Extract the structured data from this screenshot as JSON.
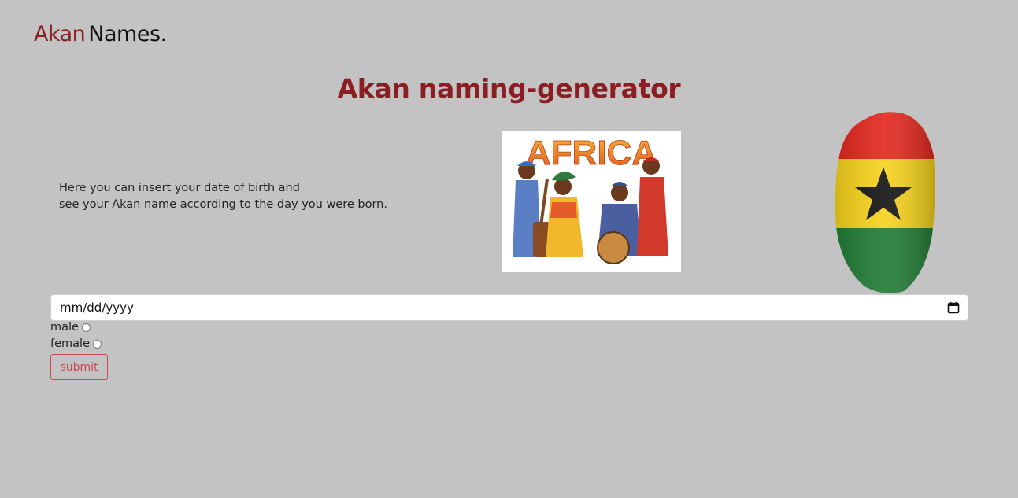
{
  "brand": {
    "accent": "Akan",
    "rest": "Names."
  },
  "title": "Akan naming-generator",
  "intro": {
    "line1": "Here you can insert your date of birth and",
    "line2": "see your Akan name according to the day you were born."
  },
  "images": {
    "africa": {
      "caption": "AFRICA",
      "icon": "africa-illustration"
    },
    "flag": {
      "icon": "ghana-flag-map"
    }
  },
  "form": {
    "date_placeholder": "mm/dd/yyyy",
    "gender_options": [
      "male",
      "female"
    ],
    "submit_label": "submit"
  },
  "colors": {
    "background": "#c3c3c3",
    "accent": "#8b1e22",
    "button": "#c9474f"
  }
}
